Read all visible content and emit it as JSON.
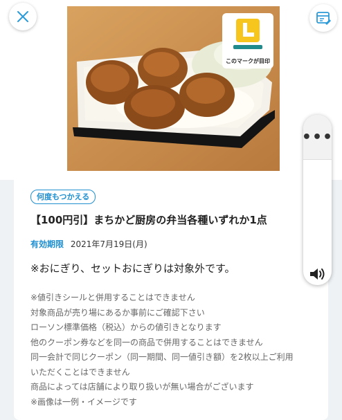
{
  "photo": {
    "alt": "唐揚げ弁当",
    "mark_letter": "L",
    "mark_text": "このマークが目印"
  },
  "buttons": {
    "close_icon": "close-icon",
    "memo_icon": "coupon-memo-icon"
  },
  "coupon": {
    "badge": "何度もつかえる",
    "title": "【100円引】まちかど厨房の弁当各種いずれか1点",
    "validity_label": "有効期限",
    "validity_date": "2021年7月19日(月)",
    "main_note": "※おにぎり、セットおにぎりは対象外です。",
    "notes": [
      "※値引きシールと併用することはできません",
      "対象商品が売り場にあるか事前にご確認下さい",
      "ローソン標準価格（税込）からの値引きとなります",
      "他のクーポン券などを同一の商品で併用することはできません",
      "同一会計で同じクーポン（同一期間、同一値引き額）を2枚以上ご利用",
      "いただくことはできません",
      "商品によっては店舗により取り扱いが無い場合がございます",
      "※画像は一例・イメージです"
    ]
  },
  "floating_panel": {
    "more_label": "•••",
    "speaker_icon": "speaker-icon"
  },
  "colors": {
    "accent": "#1f8fd0",
    "mark_yellow": "#f6c51e",
    "mark_teal": "#1f8b8c"
  }
}
